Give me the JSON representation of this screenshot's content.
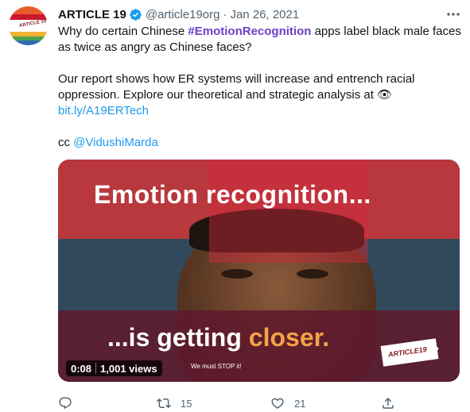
{
  "author": {
    "name": "ARTICLE 19",
    "handle": "@article19org",
    "separator": "·",
    "date": "Jan 26, 2021",
    "avatar_text": "ARTICLE 19"
  },
  "tweet": {
    "line1_prefix": "Why do certain Chinese ",
    "hashtag": "#EmotionRecognition",
    "line1_suffix": " apps label black male faces",
    "line2": "as twice as angry as Chinese faces?",
    "line3": "Our report shows how ER systems will increase and entrench racial",
    "line4": "oppression. Explore our theoretical and strategic analysis at 👁",
    "link": "bit.ly/A19ERTech",
    "cc_prefix": "cc ",
    "mention": "@VidushiMarda"
  },
  "media": {
    "headline_top": "Emotion recognition...",
    "headline_bottom_prefix": "...is getting ",
    "headline_bottom_accent": "closer.",
    "tagline": "We must STOP it!",
    "watermark": "ARTICLE19",
    "duration": "0:08",
    "views": "1,001 views"
  },
  "actions": {
    "reply_count": "",
    "retweet_count": "15",
    "like_count": "21"
  },
  "colors": {
    "link": "#1d9bf0",
    "hashtag": "#6c3fc5",
    "secondary_text": "#536471",
    "verified": "#1d9bf0",
    "accent_orange": "#f4a246"
  },
  "icons": [
    "verified-badge-icon",
    "more-options-icon",
    "reply-icon",
    "retweet-icon",
    "like-icon",
    "share-icon"
  ]
}
